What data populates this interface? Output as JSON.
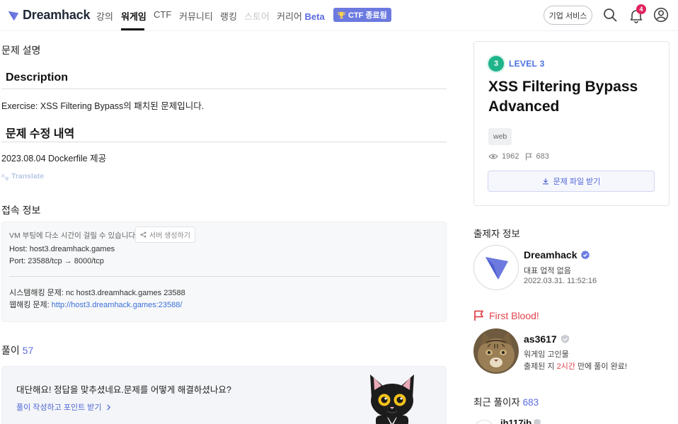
{
  "nav": {
    "brand": "Dreamhack",
    "items": [
      "강의",
      "워게임",
      "CTF",
      "커뮤니티",
      "랭킹",
      "스토어",
      "커리어"
    ],
    "beta_label": "Beta",
    "ctf_badge": "CTF 종료됨",
    "biz_button": "기업 서비스",
    "notif_count": "4",
    "colors": {
      "accent": "#5b6ce0",
      "badge_bg": "#6c7ae0",
      "notif": "#e0245e"
    }
  },
  "main": {
    "section_title": "문제 설명",
    "description_heading": "Description",
    "description_text": "Exercise: XSS Filtering Bypass의 패치된 문제입니다.",
    "revision_heading": "문제 수정 내역",
    "revision_text": "2023.08.04 Dockerfile 제공",
    "translate_label": "Translate",
    "connection": {
      "title": "접속 정보",
      "vm_note": "VM 부팅에 다소 시간이 걸릴 수 있습니다.",
      "server_button": "서버 생성하기",
      "host_line": "Host: host3.dreamhack.games",
      "port_line": "Port:  23588/tcp → 8000/tcp",
      "system_hacking": "시스템해킹 문제: nc host3.dreamhack.games 23588",
      "web_label": "웹해킹 문제: ",
      "web_url": "http://host3.dreamhack.games:23588/"
    },
    "solves_label": "풀이",
    "solves_count": "57",
    "congrats_title": "대단해요! 정답을 맞추셨네요.문제를 어떻게 해결하셨나요?",
    "congrats_link": "풀이 작성하고 포인트 받기"
  },
  "challenge": {
    "level_number": "3",
    "level_label": "LEVEL 3",
    "title": "XSS Filtering Bypass Advanced",
    "tag": "web",
    "views": "1962",
    "solvers": "683",
    "download_button": "문제 파일 받기"
  },
  "author": {
    "section_title": "출제자 정보",
    "name": "Dreamhack",
    "role": "대표 업적 없음",
    "date": "2022.03.31. 11:52:16"
  },
  "first_blood": {
    "label": "First Blood!",
    "name": "as3617",
    "title": "워게임 고인물",
    "note_before": "출제된 지 ",
    "note_time": "2시간",
    "note_after": " 만에 풀이 완료!"
  },
  "recent": {
    "label": "최근 풀이자",
    "count": "683",
    "first_name": "jh117jb"
  }
}
